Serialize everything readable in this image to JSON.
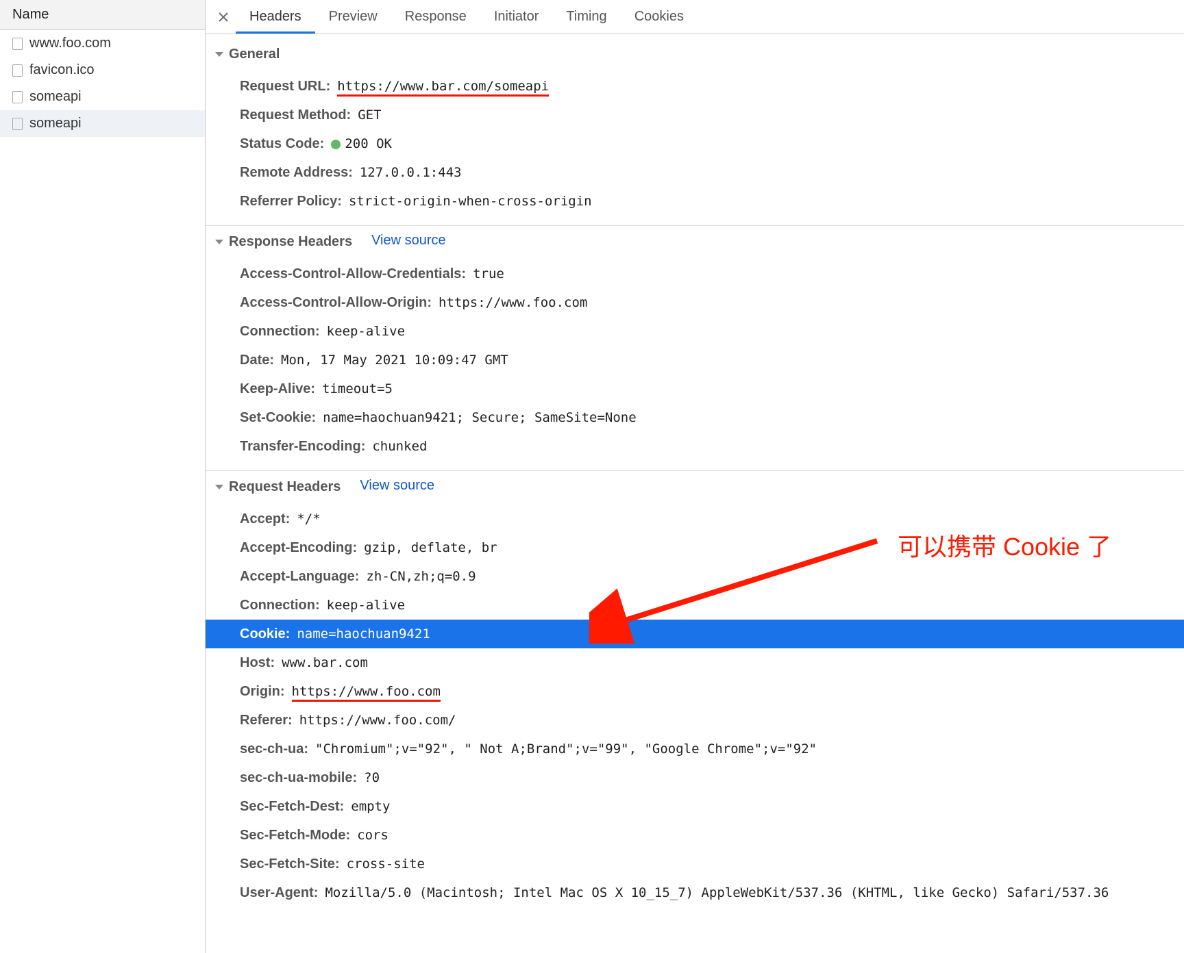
{
  "sidebar": {
    "header": "Name",
    "items": [
      {
        "name": "www.foo.com",
        "selected": false
      },
      {
        "name": "favicon.ico",
        "selected": false
      },
      {
        "name": "someapi",
        "selected": false
      },
      {
        "name": "someapi",
        "selected": true
      }
    ]
  },
  "tabs": {
    "items": [
      "Headers",
      "Preview",
      "Response",
      "Initiator",
      "Timing",
      "Cookies"
    ],
    "active_index": 0
  },
  "sections": {
    "general": {
      "title": "General",
      "rows": [
        {
          "label": "Request URL:",
          "value": "https://www.bar.com/someapi",
          "underline": true
        },
        {
          "label": "Request Method:",
          "value": "GET"
        },
        {
          "label": "Status Code:",
          "value": "200 OK",
          "status_dot": true
        },
        {
          "label": "Remote Address:",
          "value": "127.0.0.1:443"
        },
        {
          "label": "Referrer Policy:",
          "value": "strict-origin-when-cross-origin"
        }
      ]
    },
    "response_headers": {
      "title": "Response Headers",
      "view_source": "View source",
      "rows": [
        {
          "label": "Access-Control-Allow-Credentials:",
          "value": "true"
        },
        {
          "label": "Access-Control-Allow-Origin:",
          "value": "https://www.foo.com"
        },
        {
          "label": "Connection:",
          "value": "keep-alive"
        },
        {
          "label": "Date:",
          "value": "Mon, 17 May 2021 10:09:47 GMT"
        },
        {
          "label": "Keep-Alive:",
          "value": "timeout=5"
        },
        {
          "label": "Set-Cookie:",
          "value": "name=haochuan9421; Secure; SameSite=None"
        },
        {
          "label": "Transfer-Encoding:",
          "value": "chunked"
        }
      ]
    },
    "request_headers": {
      "title": "Request Headers",
      "view_source": "View source",
      "rows": [
        {
          "label": "Accept:",
          "value": "*/*"
        },
        {
          "label": "Accept-Encoding:",
          "value": "gzip, deflate, br"
        },
        {
          "label": "Accept-Language:",
          "value": "zh-CN,zh;q=0.9"
        },
        {
          "label": "Connection:",
          "value": "keep-alive"
        },
        {
          "label": "Cookie:",
          "value": "name=haochuan9421",
          "highlight": true
        },
        {
          "label": "Host:",
          "value": "www.bar.com"
        },
        {
          "label": "Origin:",
          "value": "https://www.foo.com",
          "underline": true
        },
        {
          "label": "Referer:",
          "value": "https://www.foo.com/"
        },
        {
          "label": "sec-ch-ua:",
          "value": "\"Chromium\";v=\"92\", \" Not A;Brand\";v=\"99\", \"Google Chrome\";v=\"92\""
        },
        {
          "label": "sec-ch-ua-mobile:",
          "value": "?0"
        },
        {
          "label": "Sec-Fetch-Dest:",
          "value": "empty"
        },
        {
          "label": "Sec-Fetch-Mode:",
          "value": "cors"
        },
        {
          "label": "Sec-Fetch-Site:",
          "value": "cross-site"
        },
        {
          "label": "User-Agent:",
          "value": "Mozilla/5.0 (Macintosh; Intel Mac OS X 10_15_7) AppleWebKit/537.36 (KHTML, like Gecko) Safari/537.36"
        }
      ]
    }
  },
  "annotation": {
    "text": "可以携带 Cookie 了",
    "color": "#ff1a00"
  }
}
